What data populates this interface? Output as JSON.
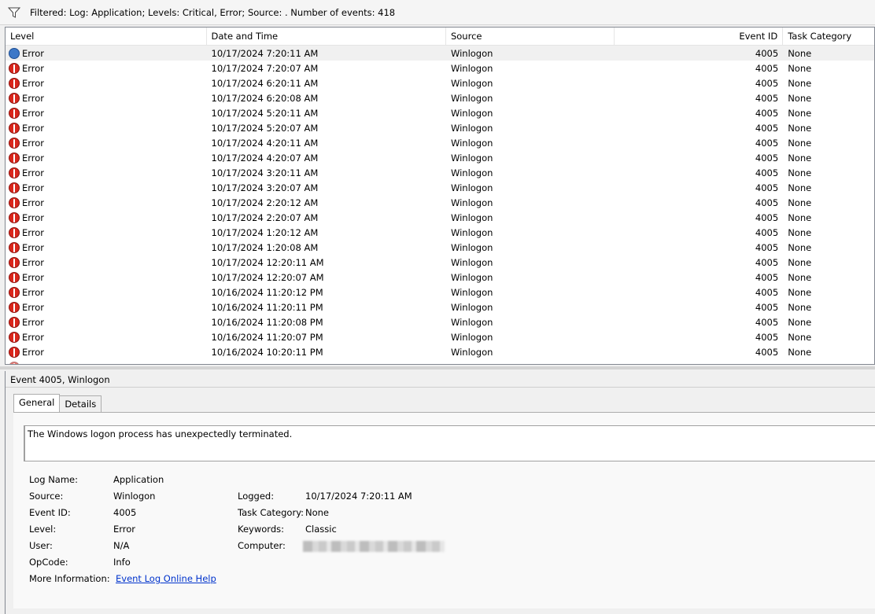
{
  "filter_bar": {
    "text": "Filtered: Log: Application; Levels: Critical, Error; Source: . Number of events: 418"
  },
  "grid": {
    "columns": {
      "level": "Level",
      "date": "Date and Time",
      "source": "Source",
      "event_id": "Event ID",
      "task": "Task Category"
    },
    "rows": [
      {
        "level": "Error",
        "date": "10/17/2024 7:20:11 AM",
        "source": "Winlogon",
        "event_id": "4005",
        "task": "None"
      },
      {
        "level": "Error",
        "date": "10/17/2024 7:20:07 AM",
        "source": "Winlogon",
        "event_id": "4005",
        "task": "None"
      },
      {
        "level": "Error",
        "date": "10/17/2024 6:20:11 AM",
        "source": "Winlogon",
        "event_id": "4005",
        "task": "None"
      },
      {
        "level": "Error",
        "date": "10/17/2024 6:20:08 AM",
        "source": "Winlogon",
        "event_id": "4005",
        "task": "None"
      },
      {
        "level": "Error",
        "date": "10/17/2024 5:20:11 AM",
        "source": "Winlogon",
        "event_id": "4005",
        "task": "None"
      },
      {
        "level": "Error",
        "date": "10/17/2024 5:20:07 AM",
        "source": "Winlogon",
        "event_id": "4005",
        "task": "None"
      },
      {
        "level": "Error",
        "date": "10/17/2024 4:20:11 AM",
        "source": "Winlogon",
        "event_id": "4005",
        "task": "None"
      },
      {
        "level": "Error",
        "date": "10/17/2024 4:20:07 AM",
        "source": "Winlogon",
        "event_id": "4005",
        "task": "None"
      },
      {
        "level": "Error",
        "date": "10/17/2024 3:20:11 AM",
        "source": "Winlogon",
        "event_id": "4005",
        "task": "None"
      },
      {
        "level": "Error",
        "date": "10/17/2024 3:20:07 AM",
        "source": "Winlogon",
        "event_id": "4005",
        "task": "None"
      },
      {
        "level": "Error",
        "date": "10/17/2024 2:20:12 AM",
        "source": "Winlogon",
        "event_id": "4005",
        "task": "None"
      },
      {
        "level": "Error",
        "date": "10/17/2024 2:20:07 AM",
        "source": "Winlogon",
        "event_id": "4005",
        "task": "None"
      },
      {
        "level": "Error",
        "date": "10/17/2024 1:20:12 AM",
        "source": "Winlogon",
        "event_id": "4005",
        "task": "None"
      },
      {
        "level": "Error",
        "date": "10/17/2024 1:20:08 AM",
        "source": "Winlogon",
        "event_id": "4005",
        "task": "None"
      },
      {
        "level": "Error",
        "date": "10/17/2024 12:20:11 AM",
        "source": "Winlogon",
        "event_id": "4005",
        "task": "None"
      },
      {
        "level": "Error",
        "date": "10/17/2024 12:20:07 AM",
        "source": "Winlogon",
        "event_id": "4005",
        "task": "None"
      },
      {
        "level": "Error",
        "date": "10/16/2024 11:20:12 PM",
        "source": "Winlogon",
        "event_id": "4005",
        "task": "None"
      },
      {
        "level": "Error",
        "date": "10/16/2024 11:20:11 PM",
        "source": "Winlogon",
        "event_id": "4005",
        "task": "None"
      },
      {
        "level": "Error",
        "date": "10/16/2024 11:20:08 PM",
        "source": "Winlogon",
        "event_id": "4005",
        "task": "None"
      },
      {
        "level": "Error",
        "date": "10/16/2024 11:20:07 PM",
        "source": "Winlogon",
        "event_id": "4005",
        "task": "None"
      },
      {
        "level": "Error",
        "date": "10/16/2024 10:20:11 PM",
        "source": "Winlogon",
        "event_id": "4005",
        "task": "None"
      }
    ]
  },
  "detail": {
    "title": "Event 4005, Winlogon",
    "tabs": {
      "general": "General",
      "details": "Details"
    },
    "description": "The Windows logon process has unexpectedly terminated.",
    "labels": {
      "log_name": "Log Name:",
      "source": "Source:",
      "event_id": "Event ID:",
      "level": "Level:",
      "user": "User:",
      "opcode": "OpCode:",
      "more_info": "More Information:",
      "logged": "Logged:",
      "task_category": "Task Category:",
      "keywords": "Keywords:",
      "computer": "Computer:"
    },
    "values": {
      "log_name": "Application",
      "source": "Winlogon",
      "event_id": "4005",
      "level": "Error",
      "user": "N/A",
      "opcode": "Info",
      "more_info_link": "Event Log Online Help",
      "logged": "10/17/2024 7:20:11 AM",
      "task_category": "None",
      "keywords": "Classic"
    }
  }
}
